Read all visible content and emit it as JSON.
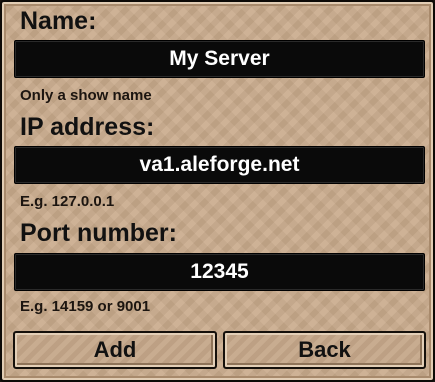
{
  "form": {
    "name": {
      "label": "Name:",
      "value": "My Server",
      "hint": "Only a show name"
    },
    "ip": {
      "label": "IP address:",
      "value": "va1.aleforge.net",
      "hint": "E.g. 127.0.0.1"
    },
    "port": {
      "label": "Port number:",
      "value": "12345",
      "hint": "E.g. 14159 or 9001"
    }
  },
  "buttons": {
    "add_label": "Add",
    "back_label": "Back"
  },
  "colors": {
    "panel": "#c9ab8c",
    "field": "#0a0a0a",
    "field_text": "#ffffff",
    "label_text": "#111111"
  }
}
